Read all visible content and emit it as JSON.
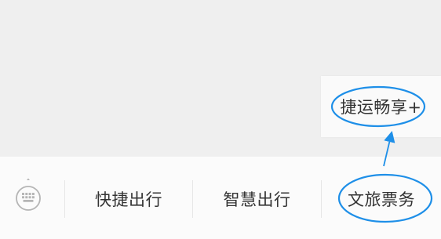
{
  "popup_menu": {
    "items": [
      {
        "label": "捷运畅享+"
      }
    ]
  },
  "bottom_menu": {
    "items": [
      {
        "label": "快捷出行"
      },
      {
        "label": "智慧出行"
      },
      {
        "label": "文旅票务"
      }
    ]
  },
  "colors": {
    "annotation": "#1e8fe8",
    "background": "#efefef",
    "menu_bar": "#fbfbfb",
    "text": "#333333"
  }
}
